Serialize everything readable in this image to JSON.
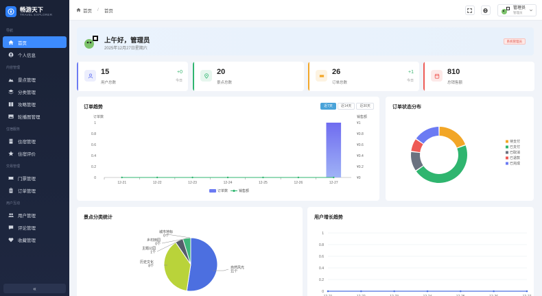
{
  "brand": {
    "title": "畅游天下",
    "subtitle": "TRAVEL EXPLORER"
  },
  "sidebar": {
    "groups": [
      {
        "label": "导航",
        "items": [
          {
            "label": "首页",
            "icon": "home-icon",
            "active": true
          },
          {
            "label": "个人信息",
            "icon": "user-circle-icon"
          }
        ]
      },
      {
        "label": "内容管理",
        "items": [
          {
            "label": "景点管理",
            "icon": "mountain-icon"
          },
          {
            "label": "分类管理",
            "icon": "layers-icon"
          },
          {
            "label": "攻略管理",
            "icon": "book-icon"
          },
          {
            "label": "轮播图管理",
            "icon": "image-icon"
          }
        ]
      },
      {
        "label": "住宿服务",
        "items": [
          {
            "label": "住宿管理",
            "icon": "building-icon"
          },
          {
            "label": "住宿评价",
            "icon": "star-icon"
          }
        ]
      },
      {
        "label": "交易管理",
        "items": [
          {
            "label": "门票管理",
            "icon": "ticket-icon"
          },
          {
            "label": "订单管理",
            "icon": "clipboard-icon"
          }
        ]
      },
      {
        "label": "用户互动",
        "items": [
          {
            "label": "用户管理",
            "icon": "users-icon"
          },
          {
            "label": "评论管理",
            "icon": "comment-icon"
          },
          {
            "label": "收藏管理",
            "icon": "heart-icon"
          }
        ]
      }
    ],
    "collapse_label": "«"
  },
  "topbar": {
    "breadcrumb_home": "首页",
    "breadcrumb_separator": "/",
    "breadcrumb_current": "首页",
    "user_name": "管理员",
    "user_role": "管理员"
  },
  "welcome": {
    "greeting": "上午好，管理员",
    "date": "2025年12月27日星期六",
    "role_badge": "系统管理员"
  },
  "stats": [
    {
      "value": "15",
      "label": "用户总数",
      "delta": "+0",
      "delta_label": "今日",
      "color": "#6c7bf3",
      "icon": "user-icon"
    },
    {
      "value": "20",
      "label": "景点总数",
      "delta": "",
      "delta_label": "",
      "color": "#2fb56f",
      "icon": "location-pin-icon"
    },
    {
      "value": "26",
      "label": "订单总数",
      "delta": "+1",
      "delta_label": "今日",
      "color": "#f2a627",
      "icon": "ticket-icon"
    },
    {
      "value": "810",
      "label": "总销售额",
      "delta": "",
      "delta_label": "",
      "color": "#ee5a55",
      "icon": "calendar-icon"
    }
  ],
  "panels": {
    "order_trend": {
      "title": "订单趋势",
      "tabs": [
        "近7天",
        "近14天",
        "近30天"
      ],
      "active_tab": 0
    },
    "order_status": {
      "title": "订单状态分布"
    },
    "spot_category": {
      "title": "景点分类统计"
    },
    "user_growth": {
      "title": "用户增长趋势"
    }
  },
  "chart_data": [
    {
      "type": "bar",
      "name": "order_trend",
      "categories": [
        "12-21",
        "12-22",
        "12-23",
        "12-24",
        "12-25",
        "12-26",
        "12-27"
      ],
      "series": [
        {
          "name": "订单数",
          "type": "bar",
          "axis": "left",
          "values": [
            0,
            0,
            0,
            0,
            0,
            0,
            1
          ],
          "color": "#6c7bf3"
        },
        {
          "name": "销售额",
          "type": "line",
          "axis": "right",
          "values": [
            0,
            0,
            0,
            0,
            0,
            0,
            0
          ],
          "color": "#2fb56f"
        }
      ],
      "ylabel": "订单数",
      "ylabel_right": "销售额",
      "ylim": [
        0,
        1
      ],
      "ylim_right": [
        0,
        1
      ],
      "yticks": [
        "0",
        "0.2",
        "0.4",
        "0.6",
        "0.8",
        "1"
      ],
      "yticks_right": [
        "¥0",
        "¥0.2",
        "¥0.4",
        "¥0.6",
        "¥0.8",
        "¥1"
      ],
      "legend": "bottom"
    },
    {
      "type": "pie",
      "name": "order_status",
      "donut": true,
      "slices": [
        {
          "label": "待支付",
          "value": 5,
          "color": "#f2a627"
        },
        {
          "label": "已支付",
          "value": 12,
          "color": "#2fb56f"
        },
        {
          "label": "已取消",
          "value": 3,
          "color": "#6b7280"
        },
        {
          "label": "已退款",
          "value": 2,
          "color": "#ee5a55"
        },
        {
          "label": "已完成",
          "value": 4,
          "color": "#6c7bf3"
        }
      ],
      "legend": "right"
    },
    {
      "type": "pie",
      "name": "spot_category",
      "slices": [
        {
          "label": "自然风光",
          "sub": "11个",
          "value": 11,
          "color": "#4c6fe0"
        },
        {
          "label": "历史文化",
          "sub": "8个",
          "value": 8,
          "color": "#b9d33a"
        },
        {
          "label": "主题公园",
          "sub": "1个",
          "value": 1,
          "color": "#3fb67a"
        },
        {
          "label": "乡村田园",
          "sub": "0个",
          "value": 0,
          "color": "#f2a627"
        },
        {
          "label": "城市地标",
          "sub": "0个",
          "value": 0,
          "color": "#6b7280"
        }
      ],
      "extra_slice": {
        "value": 1,
        "color": "#565d6b"
      }
    },
    {
      "type": "line",
      "name": "user_growth",
      "categories": [
        "12-21",
        "12-22",
        "12-23",
        "12-24",
        "12-25",
        "12-26",
        "12-27"
      ],
      "values": [
        0,
        0,
        0,
        0,
        0,
        0,
        0
      ],
      "color": "#4c6fe0",
      "ylim": [
        0,
        1
      ],
      "yticks": [
        "0",
        "0.2",
        "0.4",
        "0.6",
        "0.8",
        "1"
      ]
    }
  ]
}
